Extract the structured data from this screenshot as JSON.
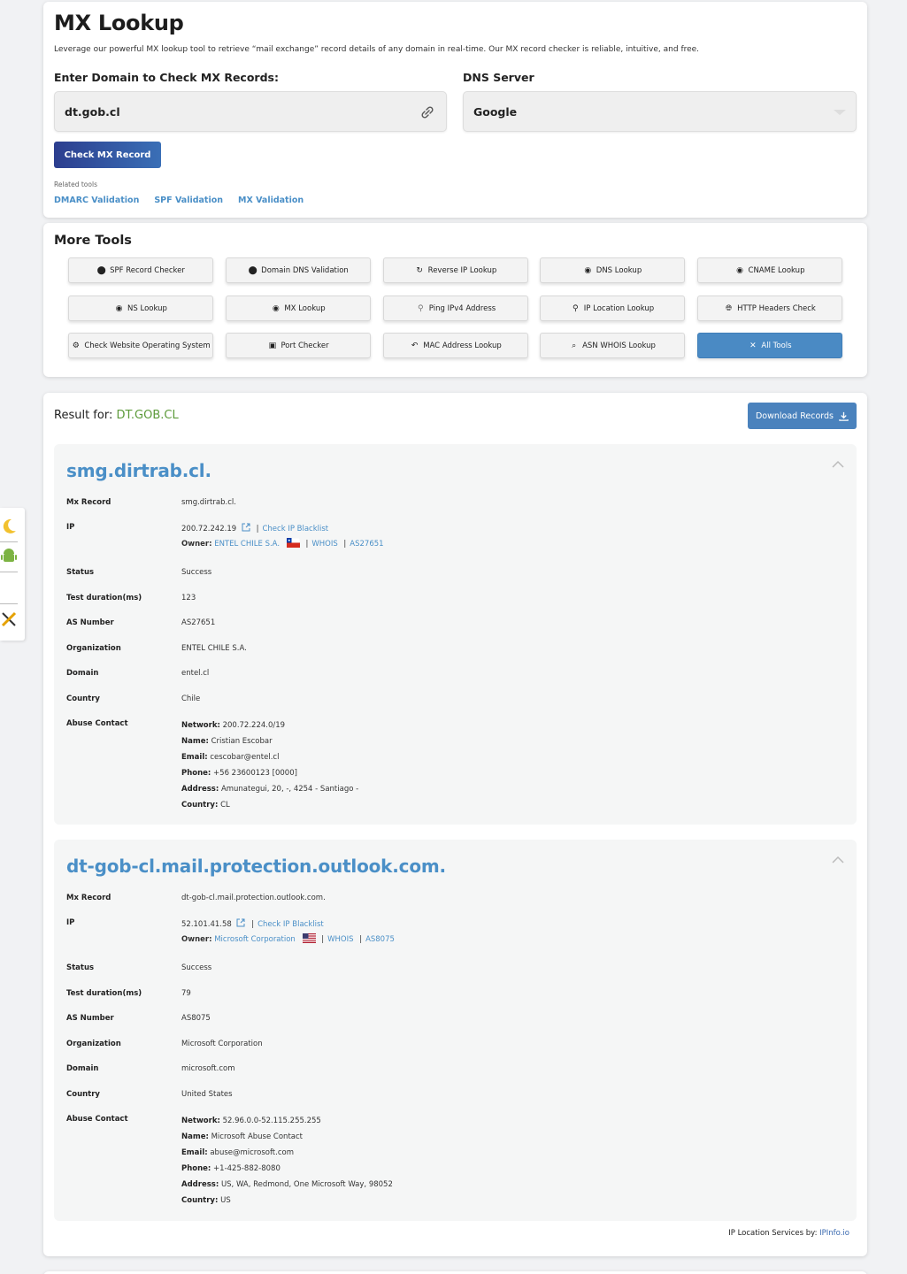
{
  "page": {
    "title": "MX Lookup",
    "intro": "Leverage our powerful MX lookup tool to retrieve “mail exchange” record details of any domain in real-time. Our MX record checker is reliable, intuitive, and free."
  },
  "form": {
    "domain_label": "Enter Domain to Check MX Records:",
    "domain_value": "dt.gob.cl",
    "dns_label": "DNS Server",
    "dns_value": "Google",
    "submit_label": "Check MX Record",
    "related_label": "Related tools",
    "related": [
      "DMARC Validation",
      "SPF Validation",
      "MX Validation"
    ]
  },
  "more_tools": {
    "title": "More Tools",
    "items": [
      {
        "label": "SPF Record Checker",
        "icon": "check-badge-icon"
      },
      {
        "label": "Domain DNS Validation",
        "icon": "check-badge-icon"
      },
      {
        "label": "Reverse IP Lookup",
        "icon": "refresh-icon"
      },
      {
        "label": "DNS Lookup",
        "icon": "dns-icon"
      },
      {
        "label": "CNAME Lookup",
        "icon": "dns-icon"
      },
      {
        "label": "NS Lookup",
        "icon": "dns-icon"
      },
      {
        "label": "MX Lookup",
        "icon": "dns-icon"
      },
      {
        "label": "Ping IPv4 Address",
        "icon": "location-pin-icon"
      },
      {
        "label": "IP Location Lookup",
        "icon": "location-pin-icon"
      },
      {
        "label": "HTTP Headers Check",
        "icon": "globe-icon"
      },
      {
        "label": "Check Website Operating System",
        "icon": "os-icon"
      },
      {
        "label": "Port Checker",
        "icon": "port-icon"
      },
      {
        "label": "MAC Address Lookup",
        "icon": "mac-icon"
      },
      {
        "label": "ASN WHOIS Lookup",
        "icon": "search-icon"
      },
      {
        "label": "All Tools",
        "icon": "tools-icon"
      }
    ]
  },
  "result": {
    "prefix": "Result for:",
    "domain": "DT.GOB.CL",
    "download_label": "Download Records",
    "records": [
      {
        "title": "smg.dirtrab.cl.",
        "labels": {
          "mx": "Mx Record",
          "ip": "IP",
          "status": "Status",
          "duration": "Test duration(ms)",
          "asn": "AS Number",
          "org": "Organization",
          "domain": "Domain",
          "country": "Country",
          "abuse": "Abuse Contact"
        },
        "mx": "smg.dirtrab.cl.",
        "ip": "200.72.242.19",
        "blacklist": "Check IP Blacklist",
        "owner_label": "Owner:",
        "owner": "ENTEL CHILE S.A.",
        "whois": "WHOIS",
        "owner_asn": "AS27651",
        "status": "Success",
        "duration": "123",
        "asn": "AS27651",
        "org": "ENTEL CHILE S.A.",
        "domain": "entel.cl",
        "country": "Chile",
        "abuse": {
          "network_label": "Network:",
          "network": "200.72.224.0/19",
          "name_label": "Name:",
          "name": "Cristian Escobar",
          "email_label": "Email:",
          "email": "cescobar@entel.cl",
          "phone_label": "Phone:",
          "phone": "+56 23600123 [0000]",
          "address_label": "Address:",
          "address": "Amunategui, 20, -, 4254 - Santiago -",
          "country_label": "Country:",
          "country": "CL"
        }
      },
      {
        "title": "dt-gob-cl.mail.protection.outlook.com.",
        "labels": {
          "mx": "Mx Record",
          "ip": "IP",
          "status": "Status",
          "duration": "Test duration(ms)",
          "asn": "AS Number",
          "org": "Organization",
          "domain": "Domain",
          "country": "Country",
          "abuse": "Abuse Contact"
        },
        "mx": "dt-gob-cl.mail.protection.outlook.com.",
        "ip": "52.101.41.58",
        "blacklist": "Check IP Blacklist",
        "owner_label": "Owner:",
        "owner": "Microsoft Corporation",
        "whois": "WHOIS",
        "owner_asn": "AS8075",
        "status": "Success",
        "duration": "79",
        "asn": "AS8075",
        "org": "Microsoft Corporation",
        "domain": "microsoft.com",
        "country": "United States",
        "abuse": {
          "network_label": "Network:",
          "network": "52.96.0.0-52.115.255.255",
          "name_label": "Name:",
          "name": "Microsoft Abuse Contact",
          "email_label": "Email:",
          "email": "abuse@microsoft.com",
          "phone_label": "Phone:",
          "phone": "+1-425-882-8080",
          "address_label": "Address:",
          "address": "US, WA, Redmond, One Microsoft Way, 98052",
          "country_label": "Country:",
          "country": "US"
        }
      }
    ],
    "footer_prefix": "IP Location Services by:",
    "footer_link": "IPInfo.io"
  },
  "colors": {
    "link": "#4a8fc7",
    "primary_button": "#2c3e8f",
    "result_domain": "#5c9a3a"
  }
}
